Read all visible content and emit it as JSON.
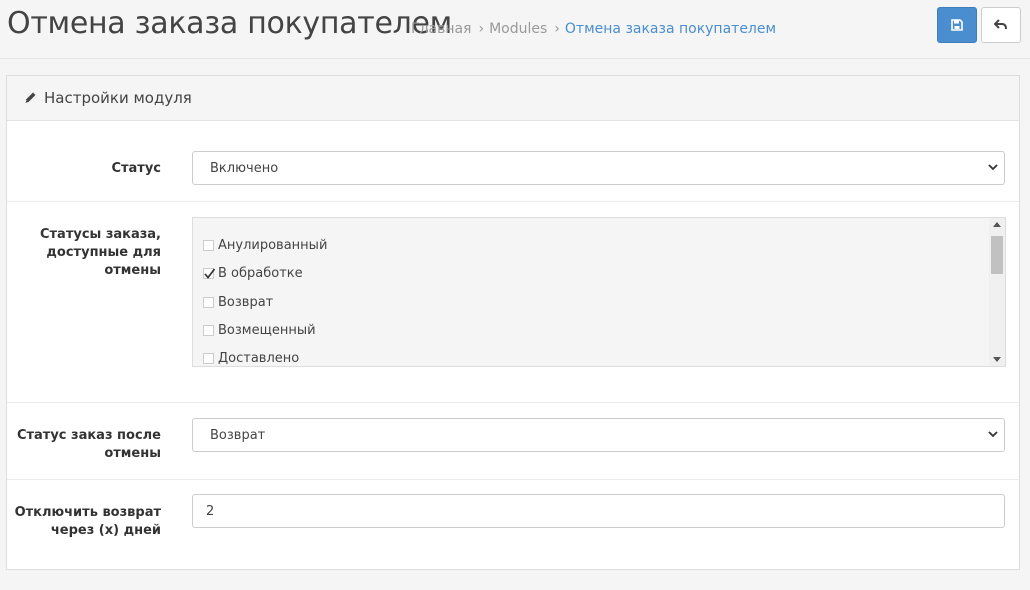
{
  "header": {
    "title": "Отмена заказа покупателем",
    "breadcrumb": [
      "Главная",
      "Modules",
      "Отмена заказа покупателем"
    ],
    "breadcrumb_separator": "›"
  },
  "toolbar": {
    "save_icon": "save-icon",
    "back_icon": "back-arrow-icon"
  },
  "panel": {
    "title": "Настройки модуля",
    "title_icon": "pencil-icon"
  },
  "form": {
    "status": {
      "label": "Статус",
      "value": "Включено"
    },
    "order_statuses": {
      "label_lines": [
        "Статусы заказа,",
        "доступные для",
        "отмены"
      ],
      "items": [
        {
          "label": "Анулированный",
          "checked": false
        },
        {
          "label": "В обработке",
          "checked": true
        },
        {
          "label": "Возврат",
          "checked": false
        },
        {
          "label": "Возмещенный",
          "checked": false
        },
        {
          "label": "Доставлено",
          "checked": false
        }
      ]
    },
    "status_after_cancel": {
      "label_lines": [
        "Статус заказ после",
        "отмены"
      ],
      "value": "Возврат"
    },
    "disable_return_days": {
      "label_lines": [
        "Отключить возврат",
        "через (х) дней"
      ],
      "value": "2"
    }
  },
  "colors": {
    "accent": "#4b8ecf",
    "background": "#f5f5f5"
  }
}
